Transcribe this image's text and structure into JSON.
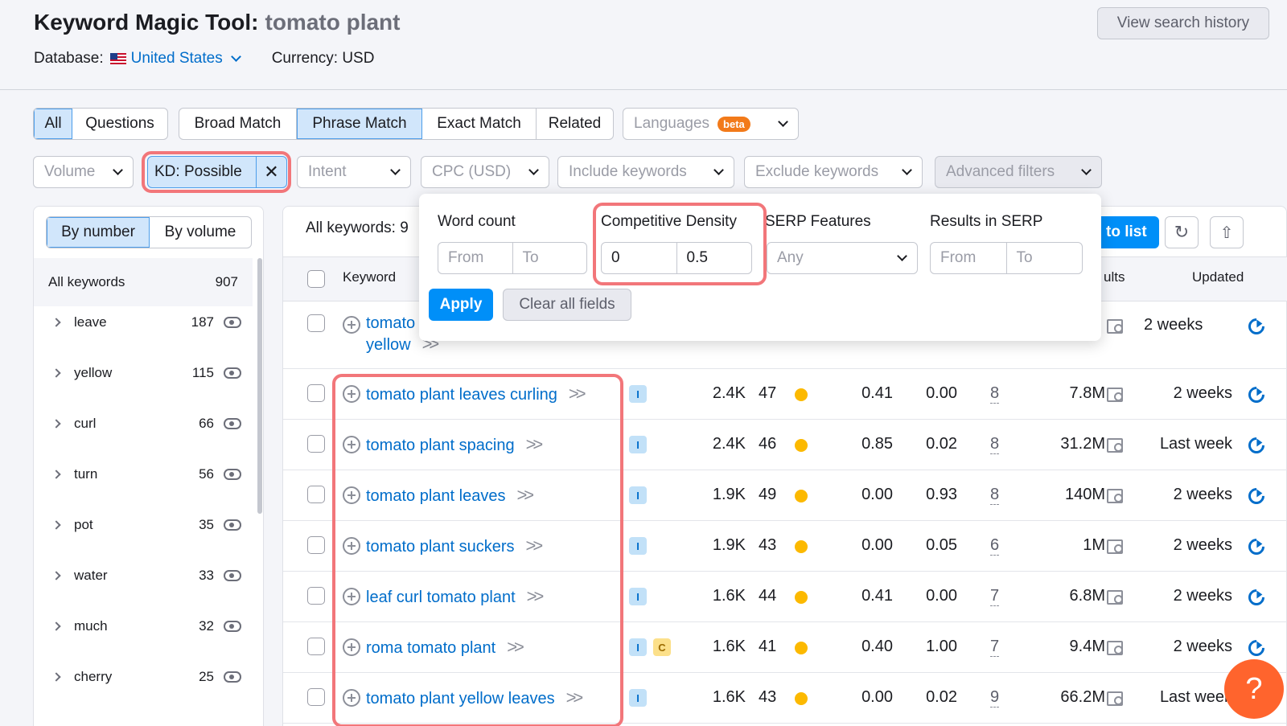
{
  "header": {
    "title": "Keyword Magic Tool:",
    "query": "tomato plant",
    "database_label": "Database:",
    "database_value": "United States",
    "currency": "Currency: USD",
    "history_button": "View search history"
  },
  "match_tabs": {
    "group1": [
      "All",
      "Questions"
    ],
    "group2": [
      "Broad Match",
      "Phrase Match",
      "Exact Match",
      "Related"
    ],
    "languages": "Languages",
    "beta": "beta"
  },
  "filters": {
    "volume": "Volume",
    "kd": "KD: Possible",
    "intent": "Intent",
    "cpc": "CPC (USD)",
    "include": "Include keywords",
    "exclude": "Exclude keywords",
    "advanced": "Advanced filters"
  },
  "sidebar": {
    "toggle": [
      "By number",
      "By volume"
    ],
    "all_label": "All keywords",
    "all_count": "907",
    "groups": [
      {
        "word": "leave",
        "count": "187"
      },
      {
        "word": "yellow",
        "count": "115"
      },
      {
        "word": "curl",
        "count": "66"
      },
      {
        "word": "turn",
        "count": "56"
      },
      {
        "word": "pot",
        "count": "35"
      },
      {
        "word": "water",
        "count": "33"
      },
      {
        "word": "much",
        "count": "32"
      },
      {
        "word": "cherry",
        "count": "25"
      }
    ]
  },
  "table": {
    "all_keywords_label": "All keywords: 9",
    "to_list": "to list",
    "col_keyword": "Keyword",
    "col_results": "ults",
    "col_updated": "Updated",
    "first_row": {
      "keyword_line1": "tomato",
      "keyword_line2": "yellow",
      "updated": "2 weeks"
    },
    "rows": [
      {
        "keyword": "tomato plant leaves curling",
        "intents": [
          "I"
        ],
        "volume": "2.4K",
        "kd": "47",
        "cpc": "0.41",
        "com": "0.00",
        "serp": "8",
        "results": "7.8M",
        "updated": "2 weeks"
      },
      {
        "keyword": "tomato plant spacing",
        "intents": [
          "I"
        ],
        "volume": "2.4K",
        "kd": "46",
        "cpc": "0.85",
        "com": "0.02",
        "serp": "8",
        "results": "31.2M",
        "updated": "Last week"
      },
      {
        "keyword": "tomato plant leaves",
        "intents": [
          "I"
        ],
        "volume": "1.9K",
        "kd": "49",
        "cpc": "0.00",
        "com": "0.93",
        "serp": "8",
        "results": "140M",
        "updated": "2 weeks"
      },
      {
        "keyword": "tomato plant suckers",
        "intents": [
          "I"
        ],
        "volume": "1.9K",
        "kd": "43",
        "cpc": "0.00",
        "com": "0.05",
        "serp": "6",
        "results": "1M",
        "updated": "2 weeks"
      },
      {
        "keyword": "leaf curl tomato plant",
        "intents": [
          "I"
        ],
        "volume": "1.6K",
        "kd": "44",
        "cpc": "0.41",
        "com": "0.00",
        "serp": "7",
        "results": "6.8M",
        "updated": "2 weeks"
      },
      {
        "keyword": "roma tomato plant",
        "intents": [
          "I",
          "C"
        ],
        "volume": "1.6K",
        "kd": "41",
        "cpc": "0.40",
        "com": "1.00",
        "serp": "7",
        "results": "9.4M",
        "updated": "2 weeks"
      },
      {
        "keyword": "tomato plant yellow leaves",
        "intents": [
          "I"
        ],
        "volume": "1.6K",
        "kd": "43",
        "cpc": "0.00",
        "com": "0.02",
        "serp": "9",
        "results": "66.2M",
        "updated": "Last week"
      }
    ]
  },
  "popup": {
    "word_count": "Word count",
    "competitive_density": "Competitive Density",
    "serp_features": "SERP Features",
    "results_in_serp": "Results in SERP",
    "from": "From",
    "to": "To",
    "cd_from": "0",
    "cd_to": "0.5",
    "any": "Any",
    "apply": "Apply",
    "clear": "Clear all fields"
  },
  "help": "?"
}
